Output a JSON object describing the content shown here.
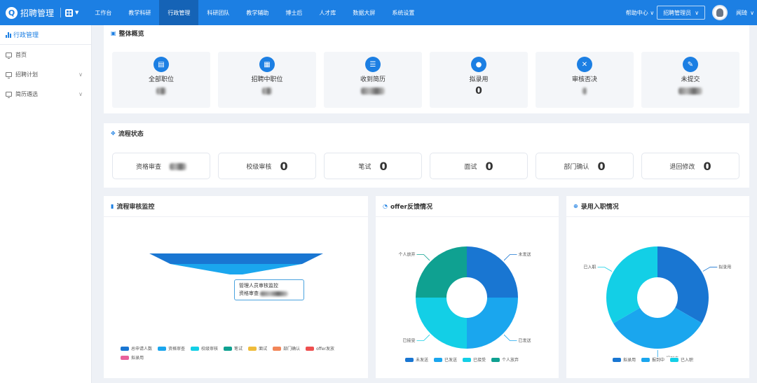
{
  "header": {
    "app_title": "招聘管理",
    "nav": [
      "工作台",
      "教学科研",
      "行政管理",
      "科研团队",
      "教学辅助",
      "博士后",
      "人才库",
      "数据大屏",
      "系统设置"
    ],
    "active_nav_index": 2,
    "help_label": "帮助中心",
    "role_label": "招聘管理员",
    "username": "闻琦"
  },
  "sidebar": {
    "section_title": "行政管理",
    "items": [
      {
        "label": "首页",
        "has_chevron": false
      },
      {
        "label": "招聘计划",
        "has_chevron": true
      },
      {
        "label": "简历遴选",
        "has_chevron": true
      }
    ]
  },
  "overview": {
    "title": "整体概览",
    "cards": [
      {
        "label": "全部职位",
        "icon": "briefcase-icon",
        "value": ""
      },
      {
        "label": "招聘中职位",
        "icon": "job-posting-icon",
        "value": ""
      },
      {
        "label": "收到简历",
        "icon": "resume-icon",
        "value": ""
      },
      {
        "label": "拟录用",
        "icon": "user-icon",
        "value": "0"
      },
      {
        "label": "审核否决",
        "icon": "reject-clipboard-icon",
        "value": ""
      },
      {
        "label": "未提交",
        "icon": "edit-icon",
        "value": ""
      }
    ]
  },
  "process": {
    "title": "流程状态",
    "cards": [
      {
        "label": "资格审查",
        "value": ""
      },
      {
        "label": "校级审核",
        "value": "0"
      },
      {
        "label": "笔试",
        "value": "0"
      },
      {
        "label": "面试",
        "value": "0"
      },
      {
        "label": "部门确认",
        "value": "0"
      },
      {
        "label": "退回修改",
        "value": "0"
      }
    ]
  },
  "funnel_panel": {
    "title": "流程审核监控",
    "tooltip_line1": "管理人员审核监控",
    "tooltip_line2": "资格审查"
  },
  "offer_panel": {
    "title": "offer反馈情况"
  },
  "onboard_panel": {
    "title": "录用入职情况"
  },
  "colors": {
    "primary": "#1c7fe3",
    "series": [
      "#1976d2",
      "#1aa6ee",
      "#13cfe6",
      "#0fa191",
      "#efbc3b",
      "#f28658",
      "#ee4f4f",
      "#e9619b"
    ]
  },
  "chart_data": [
    {
      "type": "funnel",
      "title": "流程审核监控",
      "legend": [
        "总申请人数",
        "资格审查",
        "校级审核",
        "笔试",
        "面试",
        "部门确认",
        "offer发放",
        "拟录用"
      ]
    },
    {
      "type": "pie",
      "title": "offer反馈情况",
      "donut": true,
      "labels": [
        "未发送",
        "已发送",
        "已接受",
        "个人放弃"
      ],
      "values": [
        25,
        25,
        25,
        25
      ],
      "legend_position": "bottom"
    },
    {
      "type": "pie",
      "title": "录用入职情况",
      "donut": true,
      "labels": [
        "拟录用",
        "报到中",
        "已入职"
      ],
      "values": [
        33.3,
        33.3,
        33.4
      ],
      "legend_position": "bottom"
    }
  ]
}
